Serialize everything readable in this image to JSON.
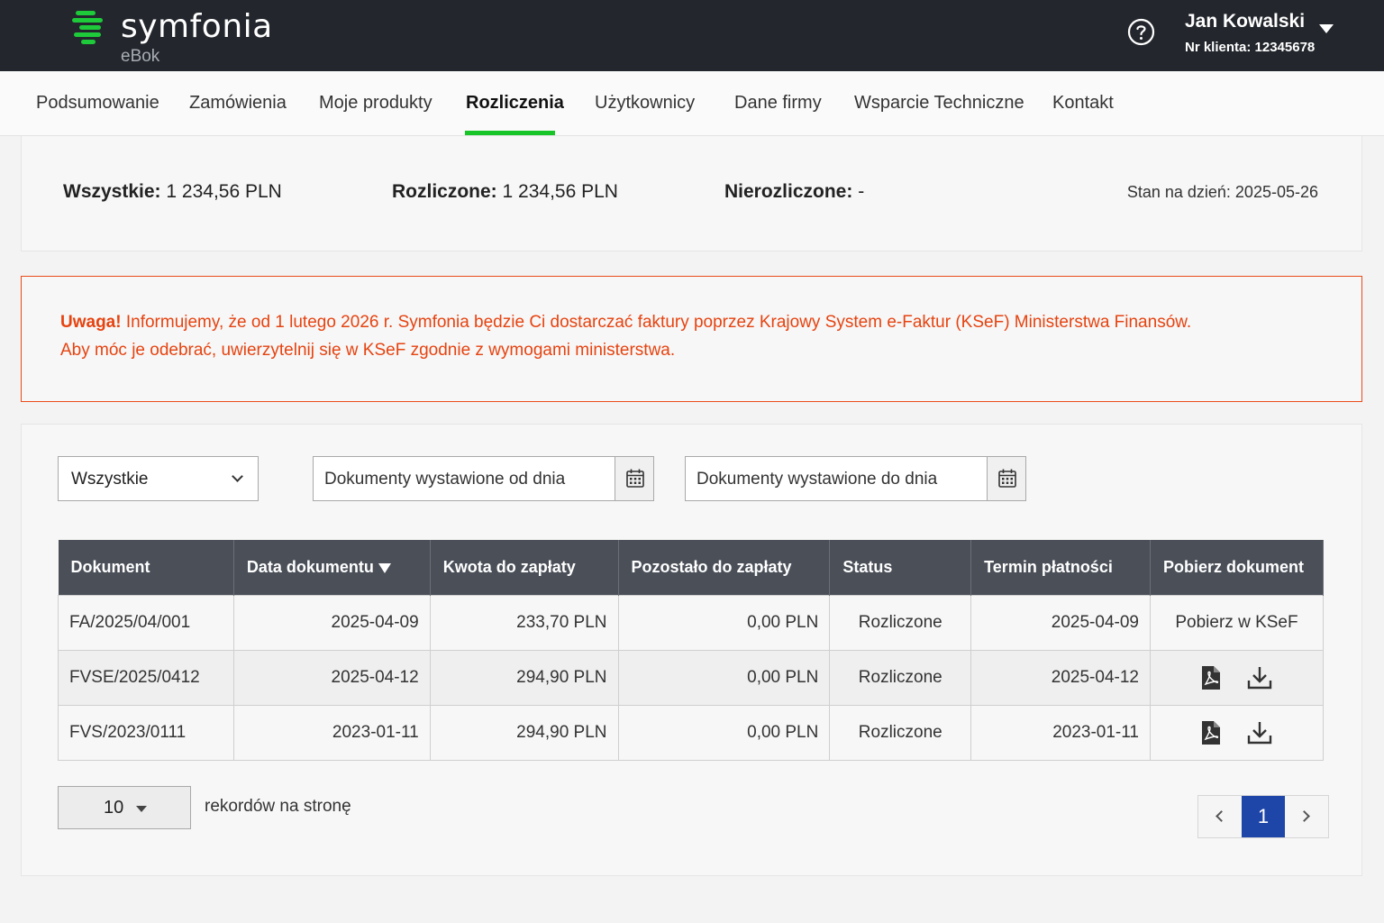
{
  "header": {
    "brand": "symfonia",
    "product": "eBok",
    "user_name": "Jan Kowalski",
    "client_label": "Nr klienta: 12345678",
    "help_icon": "question-circle-icon",
    "accent_color": "#1ec93a"
  },
  "nav": {
    "items": [
      {
        "label": "Podsumowanie"
      },
      {
        "label": "Zamówienia"
      },
      {
        "label": "Moje produkty"
      },
      {
        "label": "Rozliczenia"
      },
      {
        "label": "Użytkownicy"
      },
      {
        "label": "Dane firmy"
      },
      {
        "label": "Wsparcie Techniczne"
      },
      {
        "label": "Kontakt"
      }
    ],
    "active": "Rozliczenia"
  },
  "summary": {
    "all_label": "Wszystkie:",
    "all_value": "1 234,56 PLN",
    "settled_label": "Rozliczone:",
    "settled_value": "1 234,56 PLN",
    "unsettled_label": "Nierozliczone:",
    "unsettled_value": "-",
    "date_label": "Stan na dzień:",
    "date_value": "2025-05-26"
  },
  "alert": {
    "title": "Uwaga!",
    "line1": "Informujemy, że od 1 lutego 2026 r. Symfonia będzie Ci dostarczać faktury poprzez Krajowy System e-Faktur (KSeF) Ministerstwa Finansów.",
    "line2": "Aby móc je odebrać, uwierzytelnij się w KSeF zgodnie z wymogami ministerstwa.",
    "color": "#e64310"
  },
  "filters": {
    "status_value": "Wszystkie",
    "date_from_placeholder": "Dokumenty wystawione od dnia",
    "date_to_placeholder": "Dokumenty wystawione do dnia"
  },
  "table": {
    "headers": [
      "Dokument",
      "Data dokumentu",
      "Kwota do zapłaty",
      "Pozostało do zapłaty",
      "Status",
      "Termin płatności",
      "Pobierz dokument"
    ],
    "rows": [
      {
        "doc": "FA/2025/04/001",
        "date": "2025-04-09",
        "amount": "233,70 PLN",
        "remaining": "0,00 PLN",
        "status": "Rozliczone",
        "due": "2025-04-09",
        "download": "Pobierz w KSeF"
      },
      {
        "doc": "FVSE/2025/0412",
        "date": "2025-04-12",
        "amount": "294,90 PLN",
        "remaining": "0,00 PLN",
        "status": "Rozliczone",
        "due": "2025-04-12",
        "download": ""
      },
      {
        "doc": "FVS/2023/0111",
        "date": "2023-01-11",
        "amount": "294,90 PLN",
        "remaining": "0,00 PLN",
        "status": "Rozliczone",
        "due": "2023-01-11",
        "download": ""
      }
    ]
  },
  "pagination": {
    "per_page": "10",
    "per_page_label": "rekordów na stronę",
    "current_page": "1"
  }
}
